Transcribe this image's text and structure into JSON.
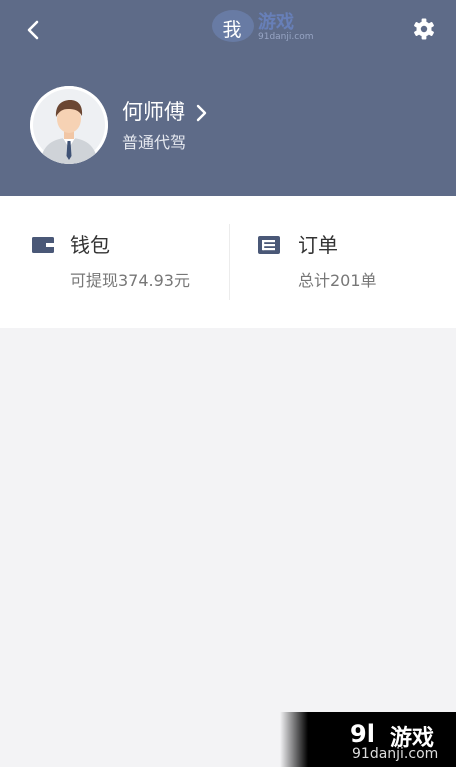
{
  "header": {
    "title": "我",
    "bg_color": "#5e6b88"
  },
  "profile": {
    "name": "何师傅",
    "role": "普通代驾"
  },
  "cards": {
    "wallet": {
      "title": "钱包",
      "subtitle": "可提现374.93元",
      "icon": "wallet-icon"
    },
    "orders": {
      "title": "订单",
      "subtitle": "总计201单",
      "icon": "order-list-icon"
    }
  },
  "watermark": {
    "top_brand": "游戏",
    "top_url": "91danji.com",
    "bottom_logo": "9l",
    "bottom_brand": "游戏",
    "bottom_url": "91danji.com"
  }
}
